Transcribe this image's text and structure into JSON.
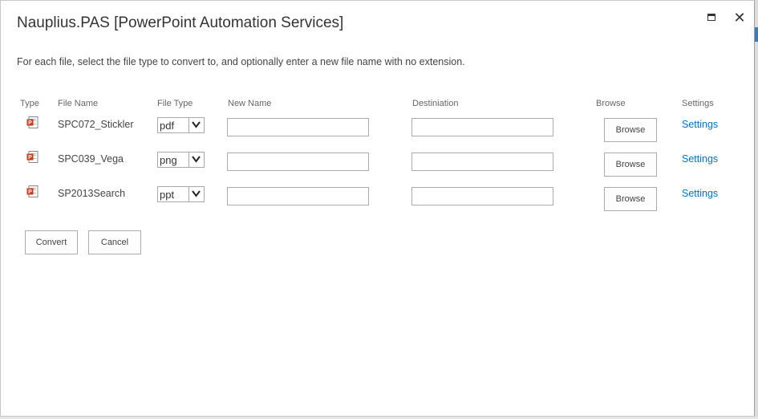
{
  "dialog": {
    "title": "Nauplius.PAS [PowerPoint Automation Services]",
    "maximize_icon": "maximize-icon",
    "close_icon": "close-icon",
    "close_glyph": "✕"
  },
  "instructions": "For each file, select the file type to convert to, and optionally enter a new file name with no extension.",
  "table": {
    "headers": {
      "type": "Type",
      "file_name": "File Name",
      "file_type": "File Type",
      "new_name": "New Name",
      "destination": "Destiniation",
      "browse": "Browse",
      "settings": "Settings"
    },
    "rows": [
      {
        "icon": "powerpoint-file-icon",
        "file_name": "SPC072_Stickler",
        "file_type": "pdf",
        "new_name": "",
        "destination": "",
        "browse_label": "Browse",
        "settings_label": "Settings"
      },
      {
        "icon": "powerpoint-file-icon",
        "file_name": "SPC039_Vega",
        "file_type": "png",
        "new_name": "",
        "destination": "",
        "browse_label": "Browse",
        "settings_label": "Settings"
      },
      {
        "icon": "powerpoint-file-icon",
        "file_name": "SP2013Search",
        "file_type": "ppt",
        "new_name": "",
        "destination": "",
        "browse_label": "Browse",
        "settings_label": "Settings"
      }
    ]
  },
  "actions": {
    "convert_label": "Convert",
    "cancel_label": "Cancel"
  },
  "colors": {
    "link": "#0072c6",
    "text": "#444444",
    "border": "#ababab",
    "ppt_icon": "#c43e1c"
  }
}
